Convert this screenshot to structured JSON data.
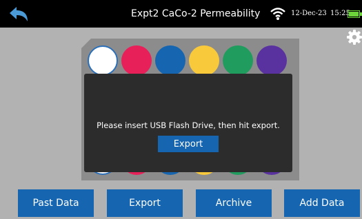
{
  "header": {
    "title": "Expt2 CaCo-2 Permeability",
    "date": "12-Dec-23",
    "time": "15:25"
  },
  "colors": {
    "accent": "#1565b0",
    "wells": [
      "#ffffff",
      "#e8205a",
      "#1565b0",
      "#f9c93c",
      "#1f9c5e",
      "#5a32a0"
    ]
  },
  "dialog": {
    "message": "Please insert USB Flash Drive, then hit export.",
    "button": "Export"
  },
  "footer": {
    "past_data": "Past Data",
    "export": "Export",
    "archive": "Archive",
    "add_data": "Add Data"
  }
}
